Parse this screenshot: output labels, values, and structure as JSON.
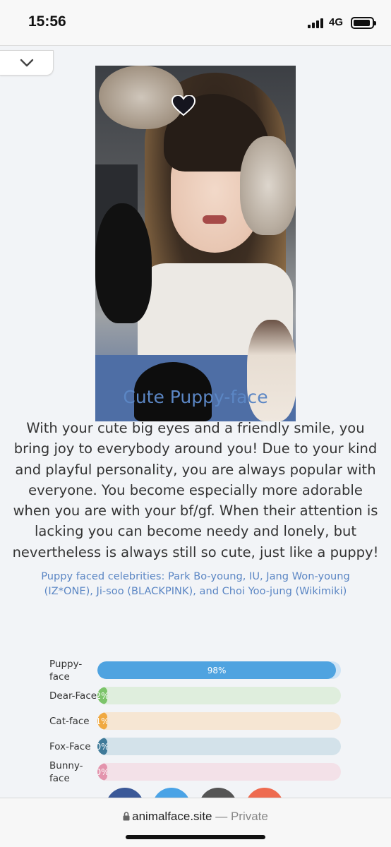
{
  "status_bar": {
    "time": "15:56",
    "network": "4G"
  },
  "nav": {
    "collapse_icon": "chevron-down-icon"
  },
  "result": {
    "title": "Cute Puppy-face",
    "description": "With your cute big eyes and a friendly smile, you bring joy to everybody around you! Due to your kind and playful personality, you are always popular with everyone. You become especially more adorable when you are with your bf/gf. When their attention is lacking you can become needy and lonely, but nevertheless is always still so cute, just like a puppy!",
    "celebrities": "Puppy faced celebrities: Park Bo-young, IU, Jang Won-young (IZ*ONE), Ji-soo (BLACKPINK), and Choi Yoo-jung (Wikimiki)"
  },
  "scores": [
    {
      "label": "Puppy-face",
      "percent": 98,
      "text": "98%",
      "color": "#4fa3e0",
      "track": "#cfe4f6"
    },
    {
      "label": "Dear-Face",
      "percent": 2,
      "text": "2%",
      "color": "#7cc46a",
      "track": "#dfeedd"
    },
    {
      "label": "Cat-face",
      "percent": 1,
      "text": "1%",
      "color": "#f0a941",
      "track": "#f6e6d3"
    },
    {
      "label": "Fox-Face",
      "percent": 0,
      "text": "0%",
      "color": "#3f7a99",
      "track": "#d3e2ea"
    },
    {
      "label": "Bunny-face",
      "percent": 0,
      "text": "0%",
      "color": "#e394ad",
      "track": "#f3e1e8"
    }
  ],
  "share_buttons": [
    {
      "name": "facebook-share-button",
      "color": "#3b5998"
    },
    {
      "name": "twitter-share-button",
      "color": "#4aa3e6"
    },
    {
      "name": "link-share-button",
      "color": "#555555"
    },
    {
      "name": "more-share-button",
      "color": "#ee6b50"
    }
  ],
  "url_bar": {
    "domain": "animalface.site",
    "separator": " — ",
    "mode": "Private"
  }
}
